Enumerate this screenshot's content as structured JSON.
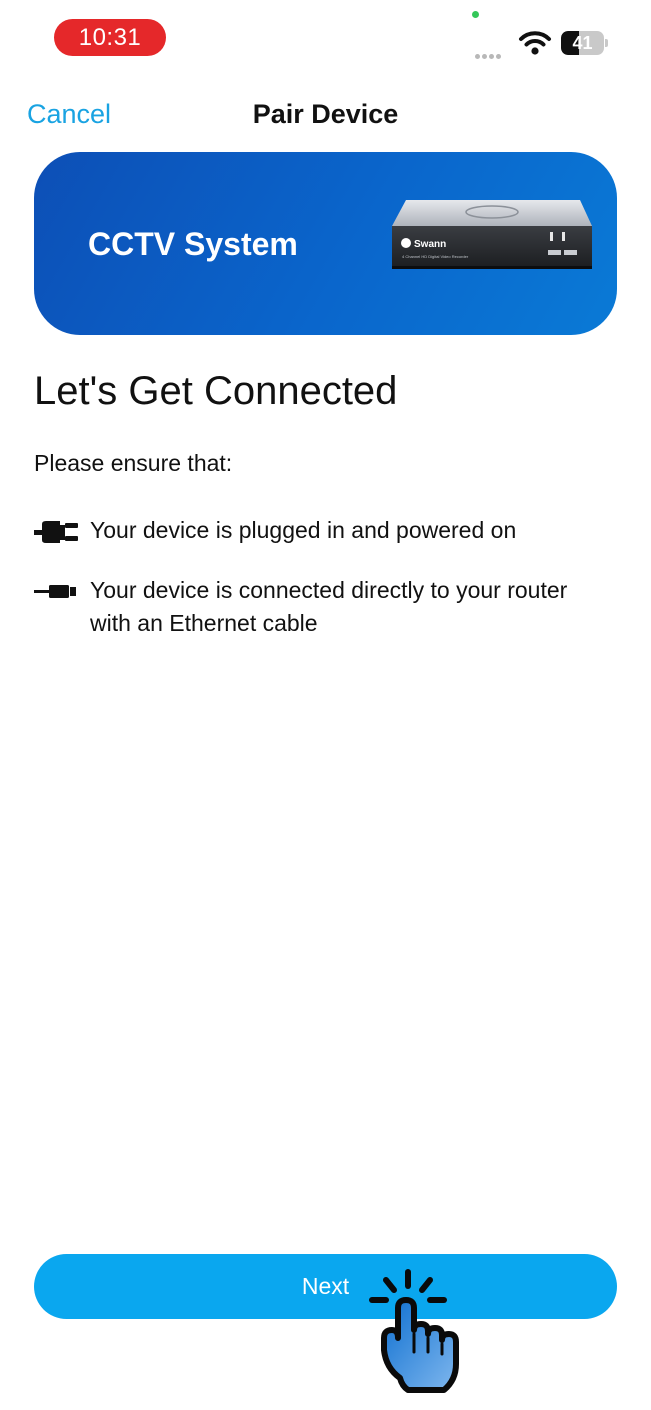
{
  "status_bar": {
    "time": "10:31",
    "battery": "41",
    "battery_level": 0.41,
    "time_badge_color": "#e5282a"
  },
  "nav": {
    "cancel_label": "Cancel",
    "title": "Pair Device",
    "accent_color": "#19a3e2"
  },
  "banner": {
    "title": "CCTV System",
    "product_brand": "Swann",
    "product_caption": "4 Channel HD Digital Video Recorder"
  },
  "main": {
    "heading": "Let's Get Connected",
    "intro": "Please ensure that:",
    "requirements": [
      {
        "icon": "power-plug-icon",
        "text": "Your device is plugged in and powered on"
      },
      {
        "icon": "ethernet-cable-icon",
        "text": "Your device is connected directly to your router with an Ethernet cable"
      }
    ]
  },
  "footer": {
    "next_label": "Next",
    "button_color": "#0aa7ef"
  },
  "overlay": {
    "icon": "tap-hand-icon"
  }
}
